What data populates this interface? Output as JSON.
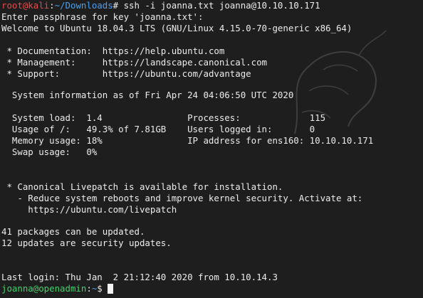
{
  "terminal": {
    "prompt1": {
      "user_host": "root@kali",
      "sep": ":",
      "path": "~/Downloads",
      "sign": "# ",
      "command": "ssh -i joanna.txt joanna@10.10.10.171"
    },
    "passphrase_prompt": "Enter passphrase for key 'joanna.txt':",
    "welcome": "Welcome to Ubuntu 18.04.3 LTS (GNU/Linux 4.15.0-70-generic x86_64)",
    "links": [
      {
        "label": " * Documentation:  ",
        "url": "https://help.ubuntu.com"
      },
      {
        "label": " * Management:     ",
        "url": "https://landscape.canonical.com"
      },
      {
        "label": " * Support:        ",
        "url": "https://ubuntu.com/advantage"
      }
    ],
    "sysinfo_header": "  System information as of Fri Apr 24 04:06:50 UTC 2020",
    "sysinfo": {
      "row1": "  System load:  1.4                Processes:             115",
      "row2": "  Usage of /:   49.3% of 7.81GB    Users logged in:       0",
      "row3": "  Memory usage: 18%                IP address for ens160: 10.10.10.171",
      "row4": "  Swap usage:   0%"
    },
    "livepatch": {
      "line1": " * Canonical Livepatch is available for installation.",
      "line2": "   - Reduce system reboots and improve kernel security. Activate at:",
      "line3": "     https://ubuntu.com/livepatch"
    },
    "updates": {
      "line1": "41 packages can be updated.",
      "line2": "12 updates are security updates."
    },
    "last_login": "Last login: Thu Jan  2 21:12:40 2020 from 10.10.14.3",
    "prompt2": {
      "user_host": "joanna@openadmin",
      "sep": ":",
      "path": "~",
      "sign": "$ "
    },
    "colors": {
      "background": "#1e1e1e",
      "root_prompt": "#e84a4a",
      "path": "#4aa0ee",
      "user_prompt": "#3fd46a",
      "text": "#ececec"
    }
  }
}
